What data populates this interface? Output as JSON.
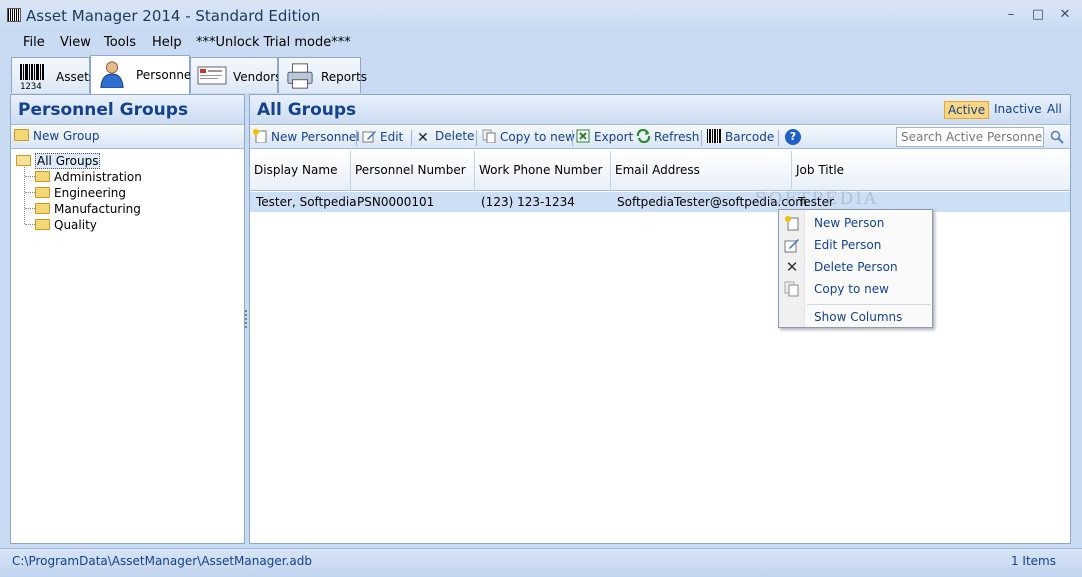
{
  "window": {
    "title": "Asset Manager 2014 - Standard Edition"
  },
  "menu": [
    "File",
    "View",
    "Tools",
    "Help",
    "***Unlock Trial mode***"
  ],
  "tabs": [
    "Assets",
    "Personnel",
    "Vendors",
    "Reports"
  ],
  "barcode_digits": "1234",
  "left_panel": {
    "title": "Personnel Groups",
    "new_group": "New Group",
    "tree_root": "All Groups",
    "groups": [
      "Administration",
      "Engineering",
      "Manufacturing",
      "Quality"
    ]
  },
  "right_panel": {
    "title": "All Groups",
    "filters": [
      "Active",
      "Inactive",
      "All"
    ],
    "toolbar": {
      "new_personnel": "New Personnel",
      "edit": "Edit",
      "delete": "Delete",
      "copy_to_new": "Copy to new",
      "export": "Export",
      "refresh": "Refresh",
      "barcode": "Barcode"
    },
    "search_placeholder": "Search Active Personnel",
    "columns": [
      "Display Name",
      "Personnel Number",
      "Work Phone Number",
      "Email Address",
      "Job Title"
    ],
    "rows": [
      {
        "display_name": "Tester, Softpedia",
        "personnel_number": "PSN0000101",
        "work_phone": "(123) 123-1234",
        "email": "SoftpediaTester@softpedia.com",
        "job_title": "Tester"
      }
    ]
  },
  "watermark": "SOFTPEDIA",
  "context_menu": {
    "items": [
      "New Person",
      "Edit Person",
      "Delete Person",
      "Copy to new",
      "Show Columns"
    ]
  },
  "status": {
    "path": "C:\\ProgramData\\AssetManager\\AssetManager.adb",
    "count": "1 Items"
  },
  "colors": {
    "accent": "#15428b",
    "active_filter": "#fbd582",
    "selected_row": "#cddff5"
  }
}
